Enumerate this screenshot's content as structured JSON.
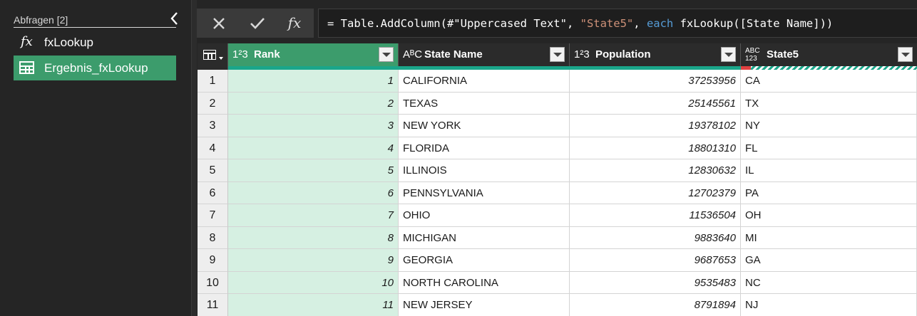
{
  "queries_pane": {
    "title": "Abfragen [2]",
    "items": [
      {
        "label": "fxLookup",
        "icon": "function-icon",
        "icon_glyph": "fx",
        "selected": false
      },
      {
        "label": "Ergebnis_fxLookup",
        "icon": "table-icon",
        "selected": true
      }
    ]
  },
  "formula_bar": {
    "cancel_icon": "close-icon",
    "commit_icon": "checkmark-icon",
    "fx_label": "fx",
    "formula_prefix": "= Table.AddColumn(#\"Uppercased Text\", ",
    "formula_string": "\"State5\"",
    "formula_mid": ", ",
    "formula_keyword": "each",
    "formula_suffix": " fxLookup([State Name]))"
  },
  "grid": {
    "columns": [
      {
        "type_label": "1²3",
        "name": "Rank",
        "quality_color": "#1aa68a"
      },
      {
        "type_label": "AᴮC",
        "name": "State Name",
        "quality_color": "#1aa68a"
      },
      {
        "type_label": "1²3",
        "name": "Population",
        "quality_color": "#1aa68a"
      },
      {
        "type_label": "ABC123",
        "name": "State5",
        "quality_color": "#e04040"
      }
    ],
    "rows": [
      {
        "n": "1",
        "rank": "1",
        "state": "CALIFORNIA",
        "pop": "37253956",
        "s5": "CA"
      },
      {
        "n": "2",
        "rank": "2",
        "state": "TEXAS",
        "pop": "25145561",
        "s5": "TX"
      },
      {
        "n": "3",
        "rank": "3",
        "state": "NEW YORK",
        "pop": "19378102",
        "s5": "NY"
      },
      {
        "n": "4",
        "rank": "4",
        "state": "FLORIDA",
        "pop": "18801310",
        "s5": "FL"
      },
      {
        "n": "5",
        "rank": "5",
        "state": "ILLINOIS",
        "pop": "12830632",
        "s5": "IL"
      },
      {
        "n": "6",
        "rank": "6",
        "state": "PENNSYLVANIA",
        "pop": "12702379",
        "s5": "PA"
      },
      {
        "n": "7",
        "rank": "7",
        "state": "OHIO",
        "pop": "11536504",
        "s5": "OH"
      },
      {
        "n": "8",
        "rank": "8",
        "state": "MICHIGAN",
        "pop": "9883640",
        "s5": "MI"
      },
      {
        "n": "9",
        "rank": "9",
        "state": "GEORGIA",
        "pop": "9687653",
        "s5": "GA"
      },
      {
        "n": "10",
        "rank": "10",
        "state": "NORTH CAROLINA",
        "pop": "9535483",
        "s5": "NC"
      },
      {
        "n": "11",
        "rank": "11",
        "state": "NEW JERSEY",
        "pop": "8791894",
        "s5": "NJ"
      }
    ]
  },
  "colors": {
    "selected_query": "#3c9c6c",
    "rank_column_fill": "#d6f0e2",
    "quality_valid": "#1aa68a",
    "quality_error": "#e04040"
  }
}
